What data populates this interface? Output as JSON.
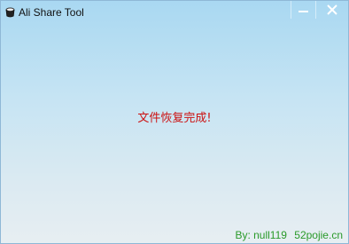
{
  "window": {
    "title": "Ali Share Tool",
    "app_icon": "teacup-icon",
    "minimize_icon": "minimize-icon",
    "close_icon": "close-icon"
  },
  "main": {
    "message": "文件恢复完成!"
  },
  "footer": {
    "author": "By: null119",
    "site": "52pojie.cn"
  },
  "colors": {
    "message": "#cc1111",
    "footer": "#2a9a2a",
    "background_top": "#a9d8f2",
    "background_bottom": "#e7eef2"
  }
}
